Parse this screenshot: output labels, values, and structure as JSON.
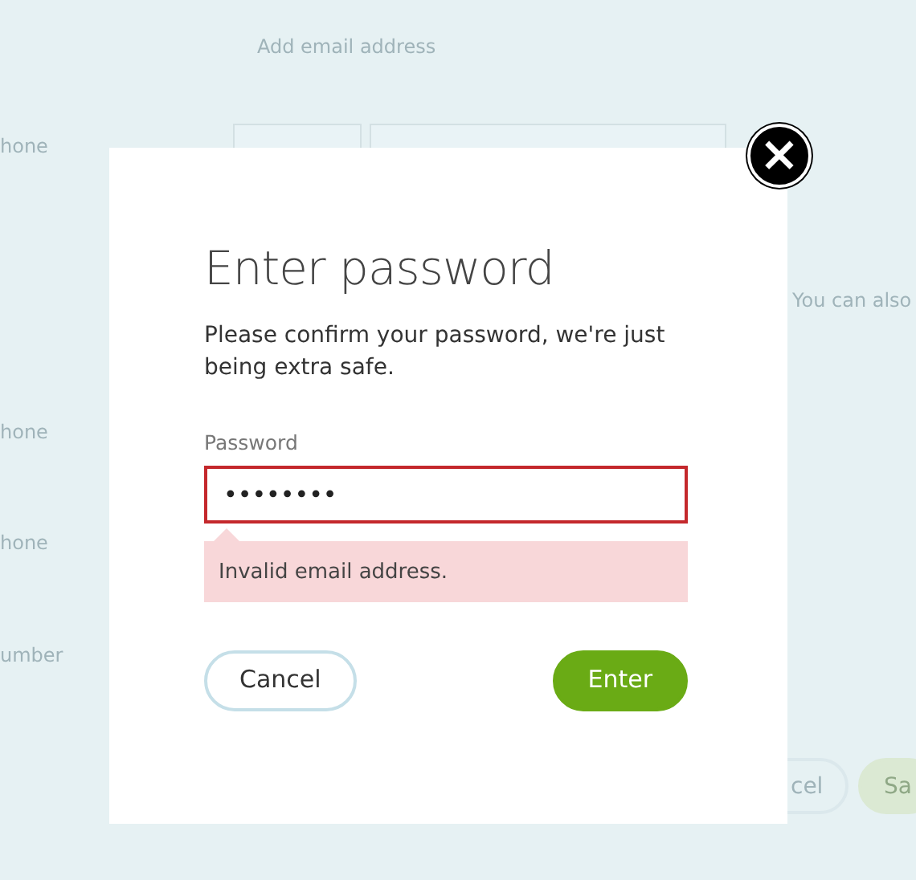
{
  "background": {
    "heading": "Add email address",
    "labels": [
      "hone",
      "hone",
      "hone",
      "umber"
    ],
    "note": "You can also",
    "buttons": [
      {
        "label": "cel",
        "kind": "outline"
      },
      {
        "label": "Sa",
        "kind": "primary"
      }
    ]
  },
  "dialog": {
    "title": "Enter password",
    "message": "Please confirm your password, we're just being extra safe.",
    "field": {
      "label": "Password",
      "value": "••••••••",
      "invalid": true
    },
    "error": "Invalid email address.",
    "buttons": [
      {
        "label": "Cancel",
        "kind": "outline"
      },
      {
        "label": "Enter",
        "kind": "primary"
      }
    ],
    "close": "×"
  }
}
